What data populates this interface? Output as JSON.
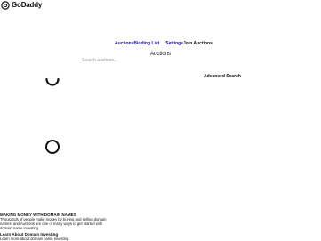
{
  "header": {
    "logo_text": "GoDaddy",
    "logo_icon": "godaddy-logo-icon"
  },
  "nav": {
    "auctions": "Auctions",
    "bidding_list": "Bidding List",
    "settings": "Settings",
    "join_auctions": "Join Auctions"
  },
  "main": {
    "title": "Auctions",
    "search_placeholder": "Search auctions...",
    "advanced_search": "Advanced Search",
    "loading_icons": [
      "loading-spinner-icon",
      "loading-spinner-icon"
    ]
  },
  "info": {
    "heading": "MAKING MONEY WITH DOMAIN NAMES",
    "body": "Thousands of people make money by buying and selling domain names, and Auctions are one of many ways to get started with domain name investing.",
    "learn_link": "Learn About Domain Investing",
    "truncated_text": "Learn more about domain name investing"
  },
  "colors": {
    "link": "#1a0dab",
    "text": "#111111",
    "placeholder": "#9a9a9a"
  }
}
